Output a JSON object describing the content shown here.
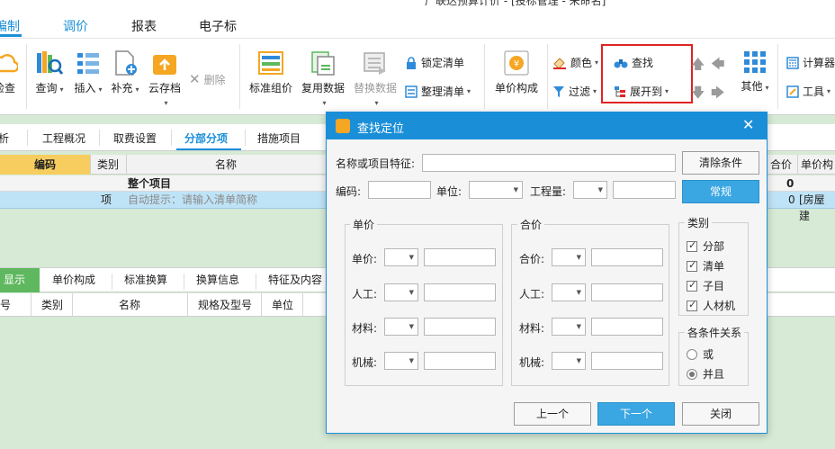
{
  "window": {
    "title": "广联达预算计价 - [投标管理 - 未命名]"
  },
  "menu_tabs": [
    {
      "label": "编制",
      "active": true
    },
    {
      "label": "调价",
      "active": false
    },
    {
      "label": "报表",
      "active": false
    },
    {
      "label": "电子标",
      "active": false
    }
  ],
  "ribbon": {
    "check": "检查",
    "query": "查询",
    "insert": "插入",
    "supplement": "补充",
    "cloud_save": "云存档",
    "delete": "删除",
    "standard_price": "标准组价",
    "reuse_data": "复用数据",
    "replace_data": "替换数据",
    "lock_list": "锁定清单",
    "organize_list": "整理清单",
    "unit_price_compose": "单价构成",
    "color": "颜色",
    "find": "查找",
    "filter": "过滤",
    "expand_to": "展开到",
    "other": "其他",
    "calculator": "计算器",
    "tools": "工具"
  },
  "sub_tabs": [
    "析",
    "工程概况",
    "取费设置",
    "分部分项",
    "措施项目"
  ],
  "active_sub_tab": "分部分项",
  "grid": {
    "headers": {
      "code": "编码",
      "type": "类别",
      "name": "名称",
      "total": "合价",
      "unit_price": "单价构"
    },
    "row_project": {
      "name": "整个项目",
      "total": "0"
    },
    "row_item": {
      "type": "项",
      "name": "自动提示：请输入清单简称",
      "total": "0",
      "unit_price": "[房屋建"
    }
  },
  "bottom_tabs": [
    "显示",
    "单价构成",
    "标准换算",
    "换算信息",
    "特征及内容"
  ],
  "bottom_headers": [
    "号",
    "类别",
    "名称",
    "规格及型号",
    "单位"
  ],
  "dialog": {
    "title": "查找定位",
    "name_label": "名称或项目特征:",
    "name_value": "",
    "clear_button": "清除条件",
    "code_label": "编码:",
    "unit_label": "单位:",
    "quantity_label": "工程量:",
    "mode_button": "常规",
    "unit_price_group": {
      "title": "单价",
      "rows": [
        "单价:",
        "人工:",
        "材料:",
        "机械:"
      ]
    },
    "total_price_group": {
      "title": "合价",
      "rows": [
        "合价:",
        "人工:",
        "材料:",
        "机械:"
      ]
    },
    "category_group": {
      "title": "类别",
      "items": [
        {
          "label": "分部",
          "checked": true
        },
        {
          "label": "清单",
          "checked": true
        },
        {
          "label": "子目",
          "checked": true
        },
        {
          "label": "人材机",
          "checked": true
        }
      ]
    },
    "relation_group": {
      "title": "各条件关系",
      "options": [
        {
          "label": "或",
          "selected": false
        },
        {
          "label": "并且",
          "selected": true
        }
      ]
    },
    "prev_button": "上一个",
    "next_button": "下一个",
    "close_button": "关闭"
  }
}
